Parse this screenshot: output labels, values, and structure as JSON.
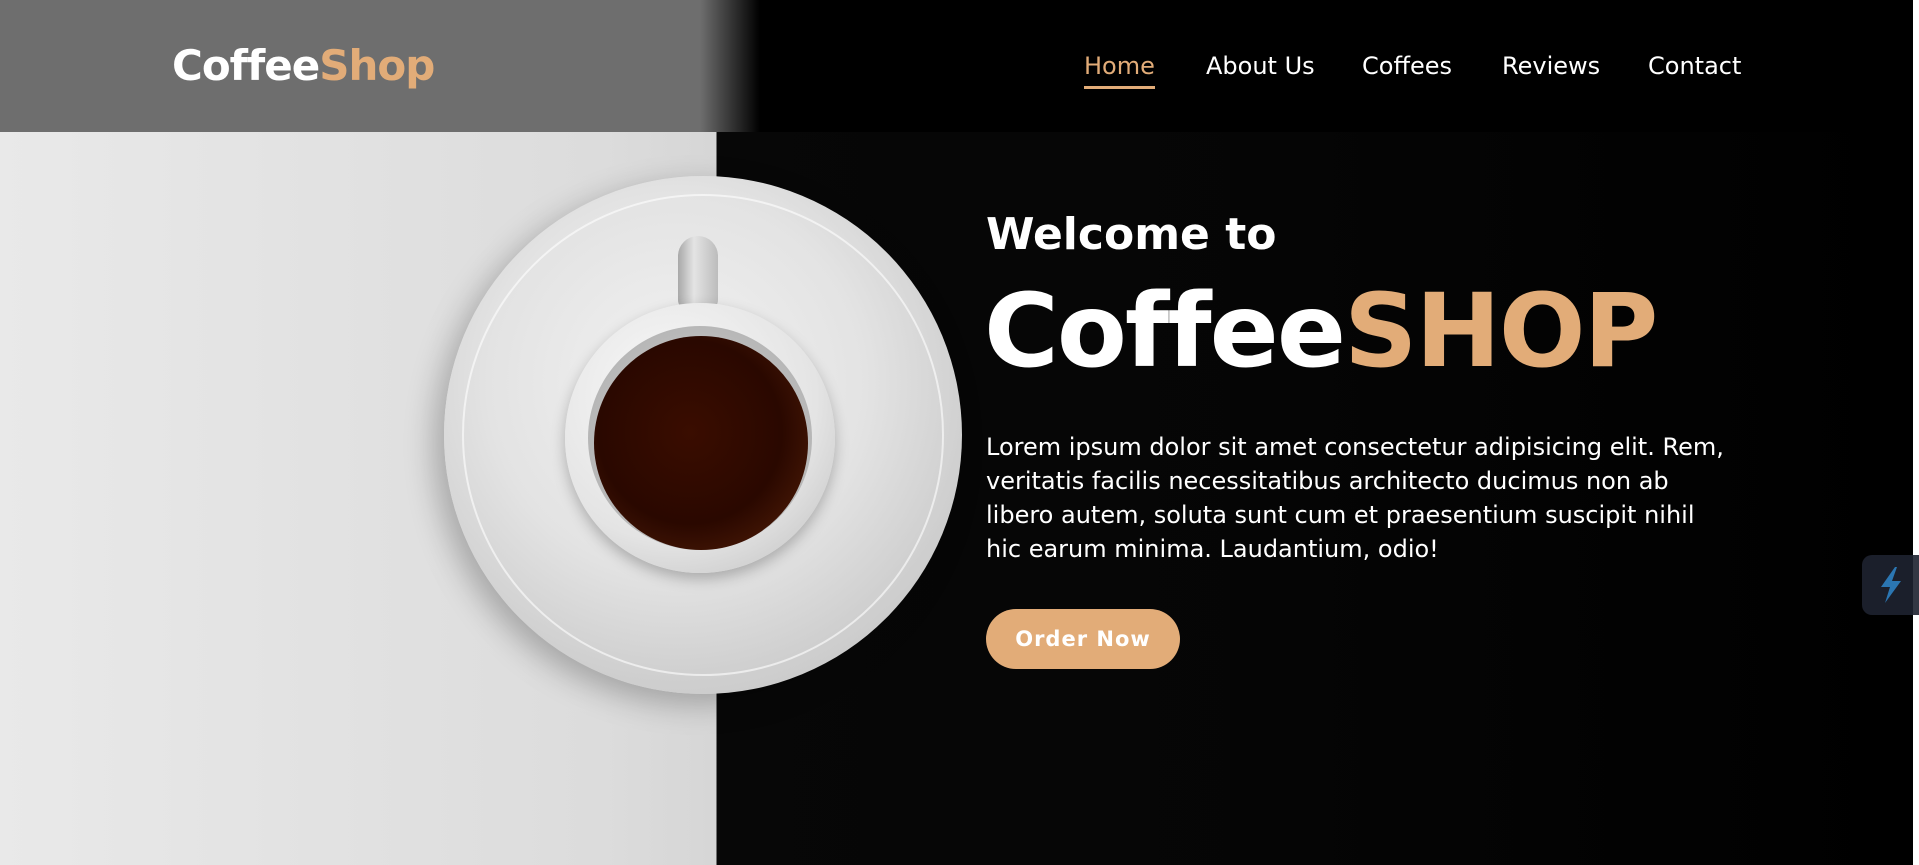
{
  "brand": {
    "logo_part1": "Coffee",
    "logo_part2": "Shop",
    "accent_color": "#e2ac78"
  },
  "nav": {
    "items": [
      {
        "label": "Home",
        "active": true
      },
      {
        "label": "About Us",
        "active": false
      },
      {
        "label": "Coffees",
        "active": false
      },
      {
        "label": "Reviews",
        "active": false
      },
      {
        "label": "Contact",
        "active": false
      }
    ]
  },
  "hero": {
    "welcome": "Welcome to",
    "title_part1": "Coffee",
    "title_part2": "SHOP",
    "description": "Lorem ipsum dolor sit amet consectetur adipisicing elit. Rem, veritatis facilis necessitatibus architecto ducimus non ab libero autem, soluta sunt cum et praesentium suscipit nihil hic earum minima. Laudantium, odio!",
    "cta_label": "Order Now",
    "image_icon": "coffee-cup-image"
  },
  "widget": {
    "icon": "lightning-icon"
  }
}
